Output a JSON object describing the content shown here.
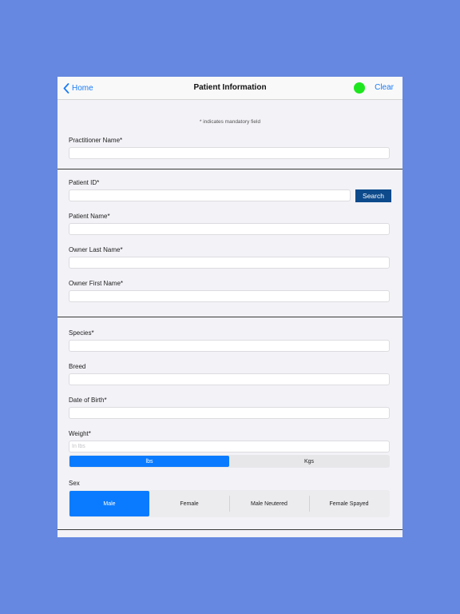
{
  "nav": {
    "back_label": "Home",
    "title": "Patient Information",
    "clear_label": "Clear",
    "status_color": "#1ee61e"
  },
  "mandatory_note": "* indicates mandatory field",
  "practitioner": {
    "label": "Practitioner Name*",
    "value": ""
  },
  "patient_id": {
    "label": "Patient ID*",
    "value": "",
    "search_label": "Search"
  },
  "patient_name": {
    "label": "Patient Name*",
    "value": ""
  },
  "owner_last_name": {
    "label": "Owner Last Name*",
    "value": ""
  },
  "owner_first_name": {
    "label": "Owner First Name*",
    "value": ""
  },
  "species": {
    "label": "Species*",
    "value": ""
  },
  "breed": {
    "label": "Breed",
    "value": ""
  },
  "dob": {
    "label": "Date of Birth*",
    "value": ""
  },
  "weight": {
    "label": "Weight*",
    "placeholder": "In lbs",
    "value": "",
    "units": [
      "lbs",
      "Kgs"
    ],
    "selected_unit": "lbs"
  },
  "sex": {
    "label": "Sex",
    "options": [
      "Male",
      "Female",
      "Male Neutered",
      "Female Spayed"
    ],
    "selected": "Male"
  },
  "colors": {
    "accent": "#0a7bff",
    "link": "#1a7cf5",
    "search_button": "#0d4a8c",
    "background": "#6688e0"
  }
}
